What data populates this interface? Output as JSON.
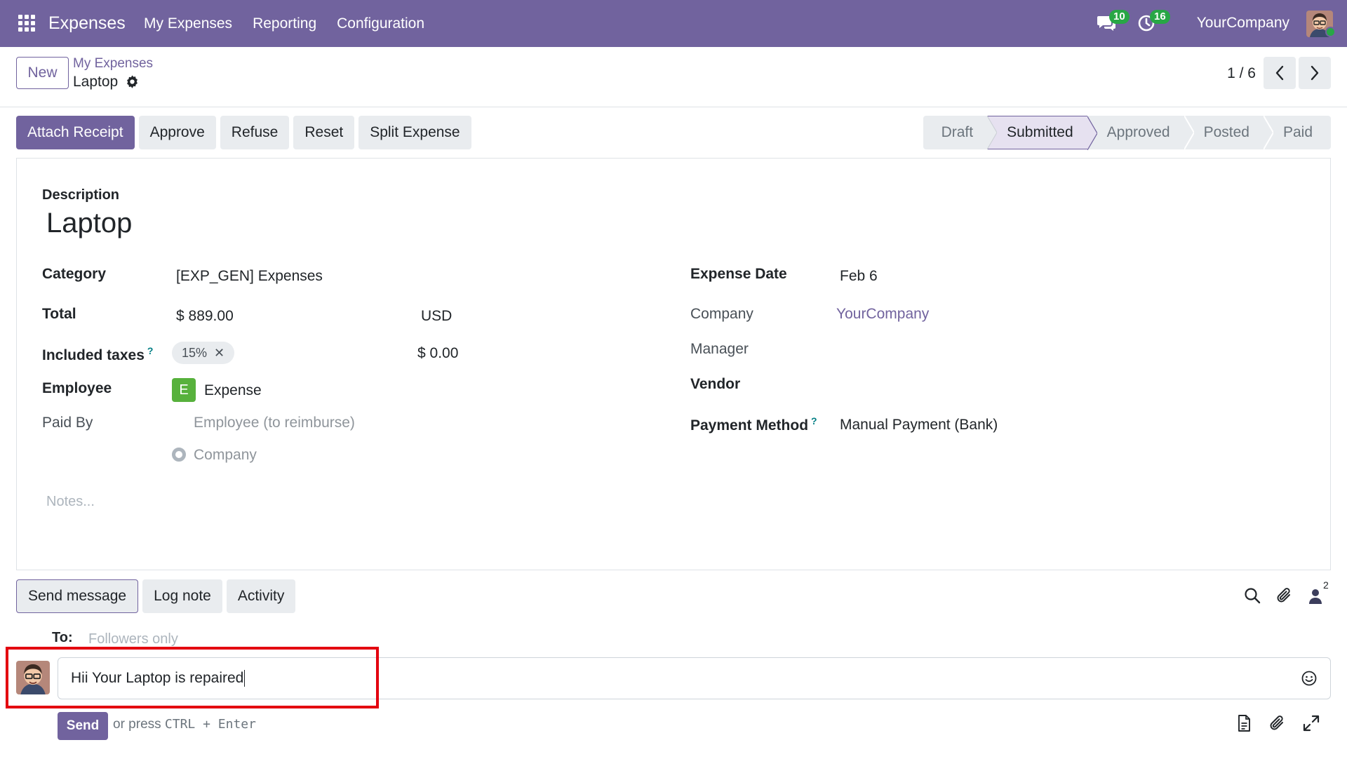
{
  "navbar": {
    "app_name": "Expenses",
    "menu": [
      "My Expenses",
      "Reporting",
      "Configuration"
    ],
    "messages_badge": "10",
    "activities_badge": "16",
    "company": "YourCompany",
    "bg_color": "#71639e"
  },
  "control_panel": {
    "new_label": "New",
    "breadcrumb_parent": "My Expenses",
    "breadcrumb_current": "Laptop",
    "pager": "1 / 6"
  },
  "actions": {
    "attach_receipt": "Attach Receipt",
    "approve": "Approve",
    "refuse": "Refuse",
    "reset": "Reset",
    "split_expense": "Split Expense"
  },
  "statusbar": {
    "stages": [
      "Draft",
      "Submitted",
      "Approved",
      "Posted",
      "Paid"
    ],
    "active": "Submitted"
  },
  "form": {
    "description_label": "Description",
    "description_value": "Laptop",
    "category_label": "Category",
    "category_value": "[EXP_GEN] Expenses",
    "total_label": "Total",
    "total_value": "$ 889.00",
    "currency": "USD",
    "taxes_label": "Included taxes",
    "tax_tag": "15%",
    "tax_amount": "$ 0.00",
    "employee_label": "Employee",
    "employee_initial": "E",
    "employee_value": "Expense",
    "paid_by_label": "Paid By",
    "paid_by_options": [
      "Employee (to reimburse)",
      "Company"
    ],
    "notes_placeholder": "Notes...",
    "expense_date_label": "Expense Date",
    "expense_date_value": "Feb 6",
    "company_label": "Company",
    "company_value": "YourCompany",
    "manager_label": "Manager",
    "vendor_label": "Vendor",
    "payment_method_label": "Payment Method",
    "payment_method_value": "Manual Payment (Bank)",
    "help_mark": "?"
  },
  "chatter": {
    "send_message": "Send message",
    "log_note": "Log note",
    "activity": "Activity",
    "followers_count": "2",
    "to_label": "To:",
    "to_value": "Followers only",
    "composer_text": "Hii Your Laptop is repaired",
    "send_label": "Send",
    "send_hint_prefix": "or press",
    "send_hint_keys": "CTRL + Enter"
  }
}
